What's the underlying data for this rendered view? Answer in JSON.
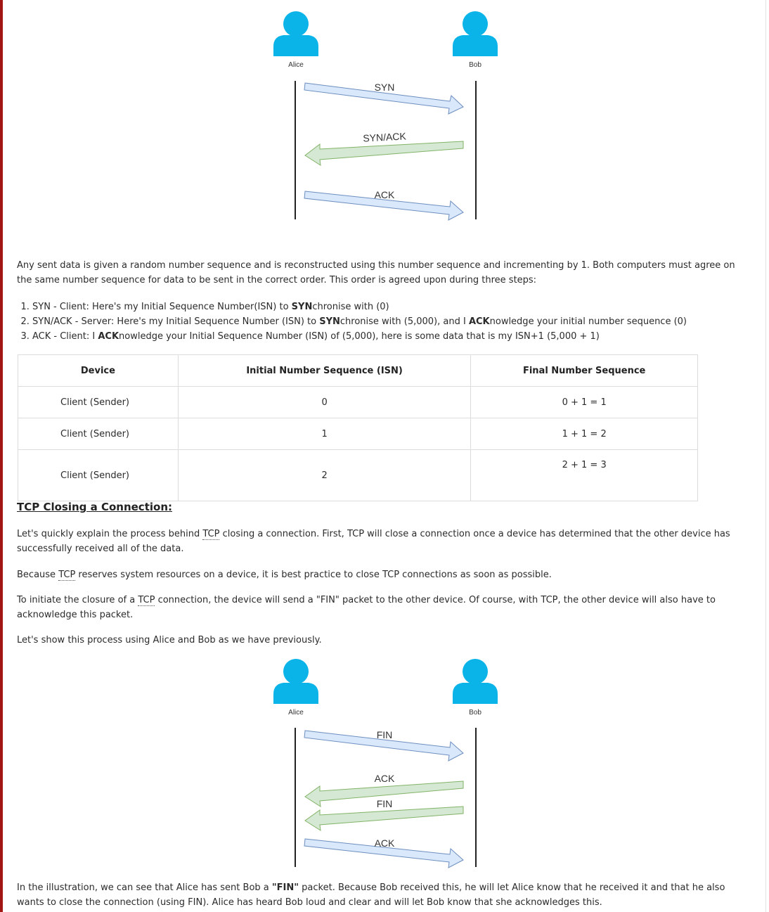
{
  "diagram_handshake": {
    "actors": {
      "left": "Alice",
      "right": "Bob"
    },
    "messages": [
      "SYN",
      "SYN/ACK",
      "ACK"
    ]
  },
  "intro_text": "Any sent data is given a random number sequence and is reconstructed using this number sequence and incrementing by 1. Both computers must agree on the same number sequence for data to be sent in the correct order. This order is agreed upon during three steps:",
  "steps": [
    {
      "pre": "SYN - Client: Here's my Initial Sequence Number(ISN) to ",
      "bold1": "SYN",
      "mid": "chronise with (0)",
      "bold2": "",
      "post": ""
    },
    {
      "pre": "SYN/ACK - Server: Here's my Initial Sequence Number (ISN) to ",
      "bold1": "SYN",
      "mid": "chronise with (5,000), and I ",
      "bold2": "ACK",
      "post": "nowledge your initial number sequence (0)"
    },
    {
      "pre": "ACK - Client: I ",
      "bold1": "ACK",
      "mid": "nowledge your Initial Sequence Number (ISN) of (5,000), here is some data that is my ISN+1 (5,000 + 1)",
      "bold2": "",
      "post": ""
    }
  ],
  "table": {
    "headers": [
      "Device",
      "Initial Number Sequence (ISN)",
      "Final Number Sequence"
    ],
    "rows": [
      [
        "Client (Sender)",
        "0",
        "0 + 1 = 1"
      ],
      [
        "Client (Sender)",
        "1",
        "1 + 1 = 2"
      ],
      [
        "Client (Sender)",
        "2",
        "2 + 1 = 3"
      ]
    ]
  },
  "closing": {
    "heading": "TCP Closing a Connection:",
    "p1_a": "Let's quickly explain the process behind ",
    "p1_abbr": "TCP",
    "p1_b": " closing a connection. First, TCP will close a connection once a device has determined that the other device has successfully received all of the data.",
    "p2_a": "Because ",
    "p2_abbr": "TCP",
    "p2_b": " reserves system resources on a device, it is best practice to close TCP connections as soon as possible.",
    "p3_a": "To initiate the closure of a ",
    "p3_abbr": "TCP",
    "p3_b": " connection, the device will send a \"FIN\" packet to the other device. Of course, with TCP, the other device will also have to acknowledge this packet.",
    "p4": "Let's show this process using Alice and Bob as we have previously."
  },
  "diagram_closing": {
    "actors": {
      "left": "Alice",
      "right": "Bob"
    },
    "messages": [
      "FIN",
      "ACK",
      "FIN",
      "ACK"
    ]
  },
  "final": {
    "a": "In the illustration, we can see that Alice has sent Bob a ",
    "bold": "\"FIN\"",
    "b": " packet. Because Bob received this, he will let Alice know that he received it and that he also wants to close the connection (using FIN). Alice has heard Bob loud and clear and will let Bob know that she acknowledges this."
  },
  "colors": {
    "accent_bar": "#a31515",
    "avatar": "#0ab3e8",
    "arrow_right_fill": "#dae8fc",
    "arrow_right_stroke": "#6c8ebf",
    "arrow_left_fill": "#d5e8d4",
    "arrow_left_stroke": "#82b366"
  }
}
